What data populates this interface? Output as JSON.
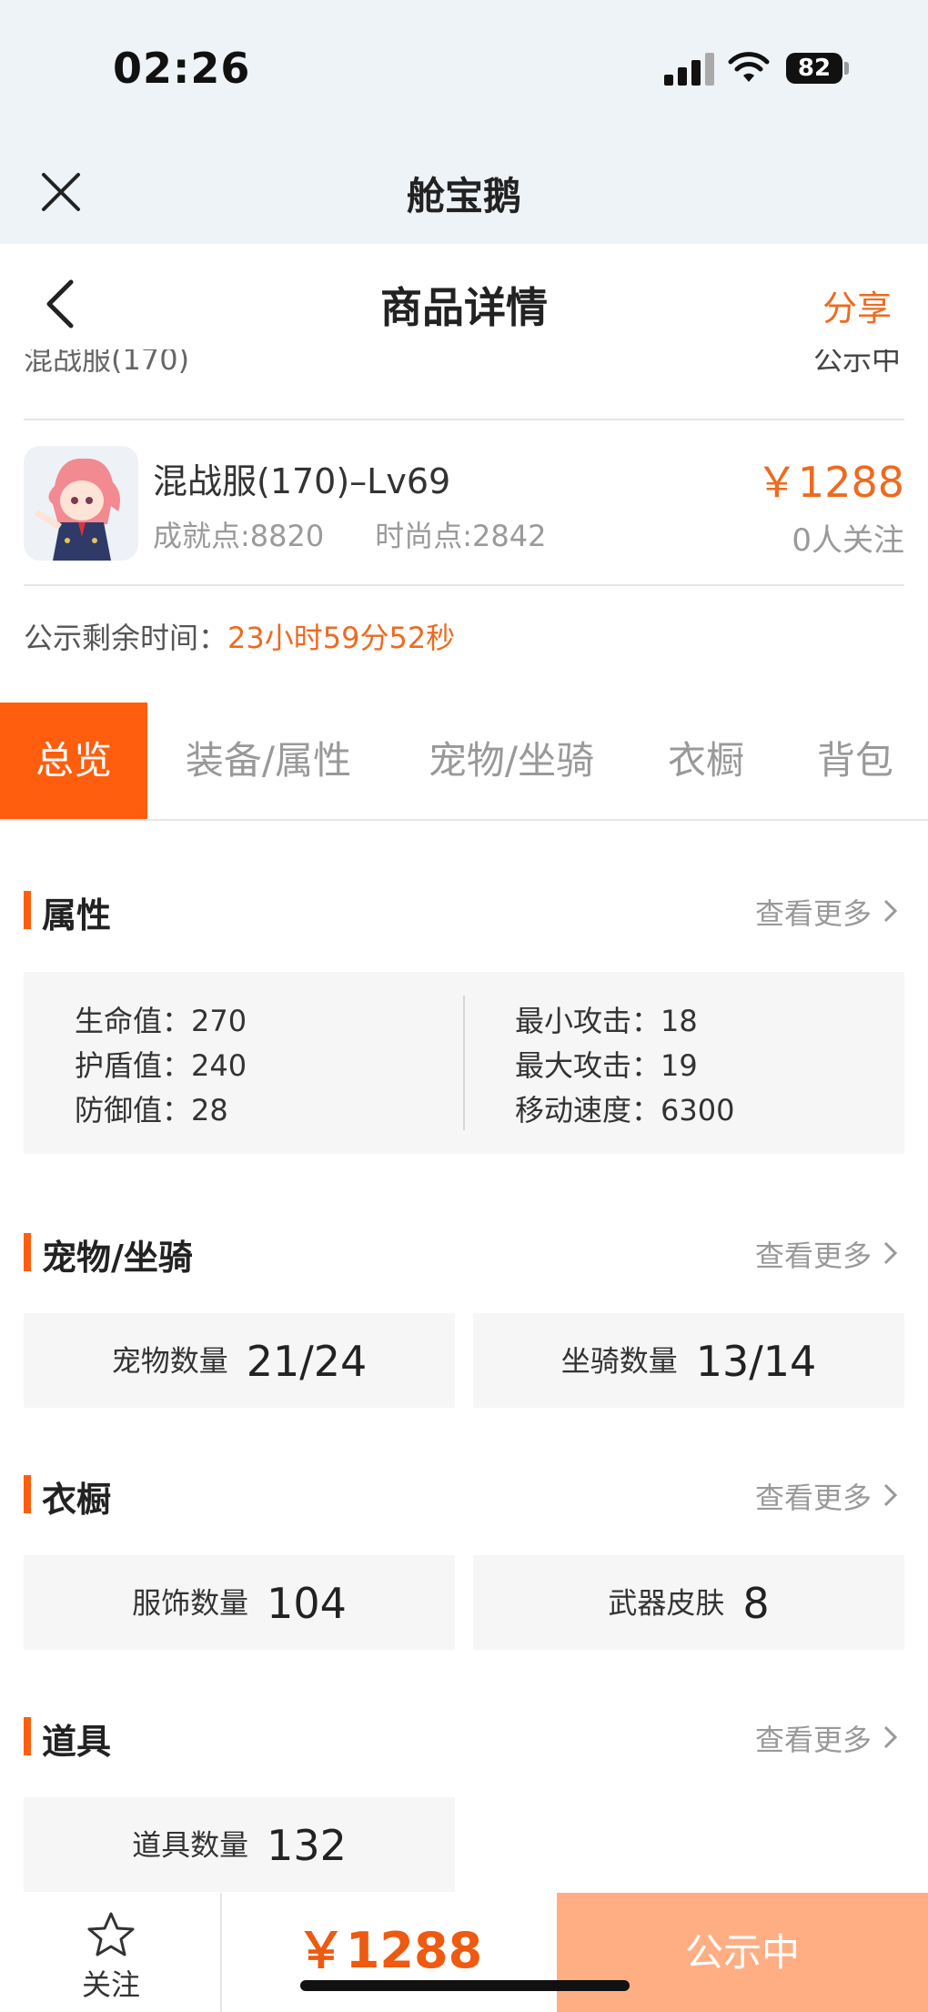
{
  "status_bar": {
    "time": "02:26",
    "battery": "82"
  },
  "webview": {
    "title": "舱宝鹅"
  },
  "nav": {
    "title": "商品详情",
    "share": "分享"
  },
  "clipped_row": {
    "left": "混战服(170)",
    "right": "公示中"
  },
  "product": {
    "title": "混战服(170)–Lv69",
    "achievement": "成就点:8820",
    "fashion": "时尚点:2842",
    "price": "￥1288",
    "followers": "0人关注"
  },
  "countdown": {
    "label": "公示剩余时间：",
    "value": "23小时59分52秒"
  },
  "tabs": [
    "总览",
    "装备/属性",
    "宠物/坐骑",
    "衣橱",
    "背包"
  ],
  "active_tab": 0,
  "sections": {
    "attributes": {
      "title": "属性",
      "more": "查看更多"
    },
    "pets": {
      "title": "宠物/坐骑",
      "more": "查看更多"
    },
    "wardrobe": {
      "title": "衣橱",
      "more": "查看更多"
    },
    "items": {
      "title": "道具",
      "more": "查看更多"
    }
  },
  "attributes": {
    "left": [
      {
        "label": "生命值：",
        "value": "270"
      },
      {
        "label": "护盾值：",
        "value": "240"
      },
      {
        "label": "防御值：",
        "value": "28"
      }
    ],
    "right": [
      {
        "label": "最小攻击：",
        "value": "18"
      },
      {
        "label": "最大攻击：",
        "value": "19"
      },
      {
        "label": "移动速度：",
        "value": "6300"
      }
    ]
  },
  "pets": [
    {
      "label": "宠物数量",
      "value": "21/24"
    },
    {
      "label": "坐骑数量",
      "value": "13/14"
    }
  ],
  "wardrobe": [
    {
      "label": "服饰数量",
      "value": "104"
    },
    {
      "label": "武器皮肤",
      "value": "8"
    }
  ],
  "items": [
    {
      "label": "道具数量",
      "value": "132"
    }
  ],
  "bottom": {
    "follow": "关注",
    "price": "￥1288",
    "status": "公示中"
  },
  "colors": {
    "accent": "#ff5e0e",
    "price": "#ee6a1f",
    "status_button": "#ffae84"
  }
}
